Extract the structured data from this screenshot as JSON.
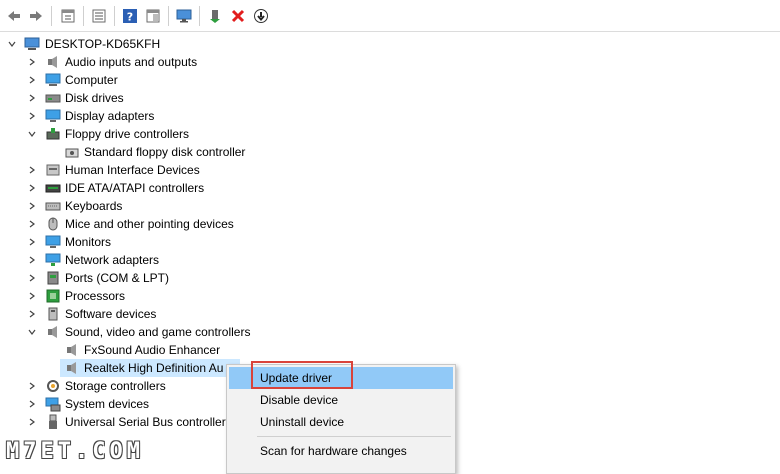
{
  "toolbar": {
    "buttons": [
      "back-icon",
      "forward-icon",
      "properties-icon",
      "device-list-icon",
      "help-icon",
      "action-pane-icon",
      "monitor-scan-icon",
      "add-driver-icon",
      "uninstall-icon",
      "download-driver-icon"
    ]
  },
  "tree": {
    "root": "DESKTOP-KD65KFH",
    "items": [
      {
        "label": "Audio inputs and outputs",
        "icon": "speaker-icon",
        "expanded": false
      },
      {
        "label": "Computer",
        "icon": "computer-icon",
        "expanded": false
      },
      {
        "label": "Disk drives",
        "icon": "disk-icon",
        "expanded": false
      },
      {
        "label": "Display adapters",
        "icon": "display-adapter-icon",
        "expanded": false
      },
      {
        "label": "Floppy drive controllers",
        "icon": "floppy-controller-icon",
        "expanded": true
      },
      {
        "label": "Standard floppy disk controller",
        "icon": "floppy-device-icon",
        "child": true
      },
      {
        "label": "Human Interface Devices",
        "icon": "hid-icon",
        "expanded": false
      },
      {
        "label": "IDE ATA/ATAPI controllers",
        "icon": "ide-icon",
        "expanded": false
      },
      {
        "label": "Keyboards",
        "icon": "keyboard-icon",
        "expanded": false
      },
      {
        "label": "Mice and other pointing devices",
        "icon": "mouse-icon",
        "expanded": false
      },
      {
        "label": "Monitors",
        "icon": "monitor-icon",
        "expanded": false
      },
      {
        "label": "Network adapters",
        "icon": "network-icon",
        "expanded": false
      },
      {
        "label": "Ports (COM & LPT)",
        "icon": "port-icon",
        "expanded": false
      },
      {
        "label": "Processors",
        "icon": "processor-icon",
        "expanded": false
      },
      {
        "label": "Software devices",
        "icon": "software-device-icon",
        "expanded": false
      },
      {
        "label": "Sound, video and game controllers",
        "icon": "sound-icon",
        "expanded": true
      },
      {
        "label": "FxSound Audio Enhancer",
        "icon": "speaker-icon",
        "child": true
      },
      {
        "label": "Realtek High Definition Au",
        "icon": "speaker-icon",
        "child": true,
        "selected": true
      },
      {
        "label": "Storage controllers",
        "icon": "storage-icon",
        "expanded": false
      },
      {
        "label": "System devices",
        "icon": "system-device-icon",
        "expanded": false
      },
      {
        "label": "Universal Serial Bus controllers",
        "icon": "usb-icon",
        "expanded": false
      }
    ]
  },
  "context_menu": {
    "items": [
      "Update driver",
      "Disable device",
      "Uninstall device",
      "Scan for hardware changes"
    ]
  },
  "watermark": "M7ET.COM",
  "colors": {
    "menu_highlight": "#91c9f7",
    "highlight_outline": "#d9433a",
    "selected_row": "#cce8ff"
  }
}
